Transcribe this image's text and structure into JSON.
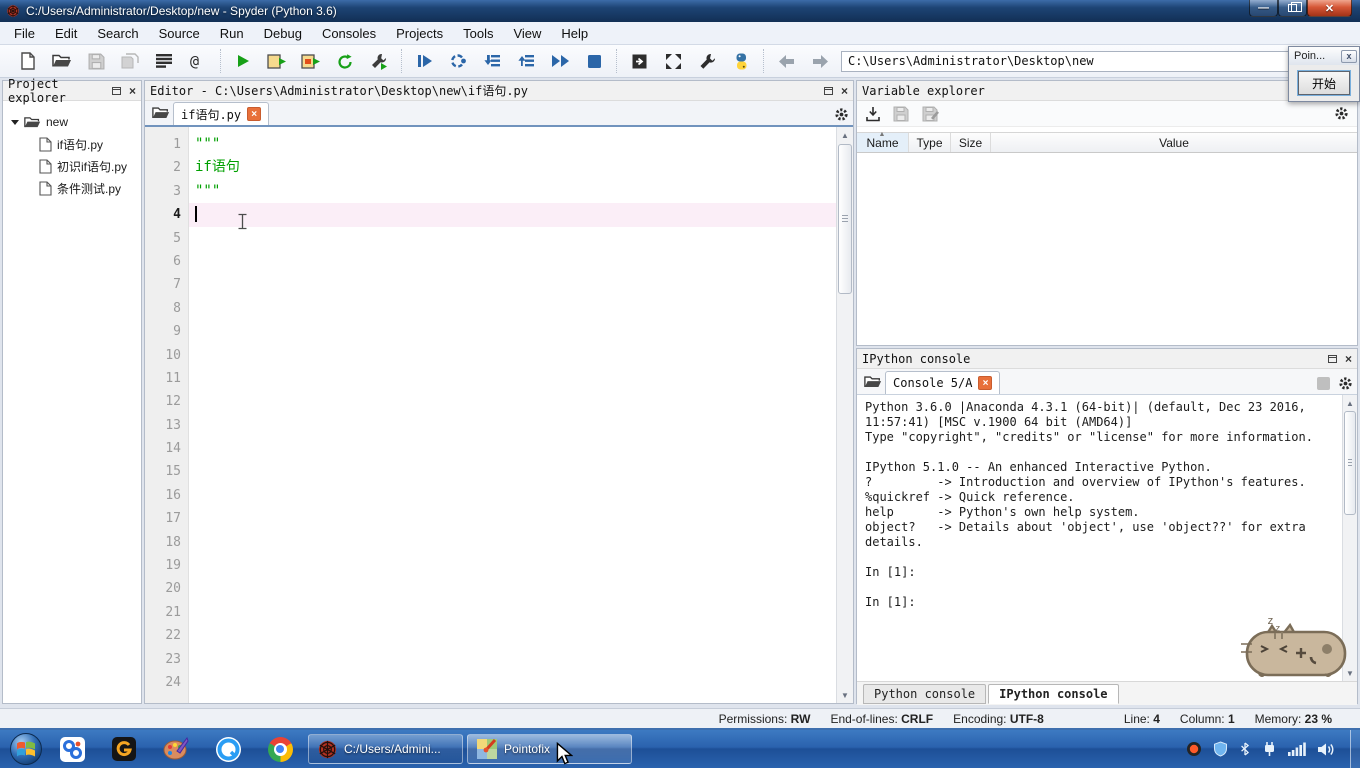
{
  "window": {
    "title": "C:/Users/Administrator/Desktop/new - Spyder (Python 3.6)"
  },
  "menu": {
    "items": [
      "File",
      "Edit",
      "Search",
      "Source",
      "Run",
      "Debug",
      "Consoles",
      "Projects",
      "Tools",
      "View",
      "Help"
    ]
  },
  "toolbar": {
    "path": "C:\\Users\\Administrator\\Desktop\\new"
  },
  "pointofix_window": {
    "title": "Poin...",
    "start_button": "开始"
  },
  "project_explorer": {
    "title": "Project explorer",
    "root_folder": "new",
    "files": [
      "if语句.py",
      "初识if语句.py",
      "条件测试.py"
    ]
  },
  "editor": {
    "title": "Editor - C:\\Users\\Administrator\\Desktop\\new\\if语句.py",
    "tab_label": "if语句.py",
    "total_lines": 24,
    "current_line": 4,
    "code_lines": {
      "1": "\"\"\"",
      "2": "if语句",
      "3": "\"\"\""
    }
  },
  "variable_explorer": {
    "title": "Variable explorer",
    "columns": [
      "Name",
      "Type",
      "Size",
      "Value"
    ]
  },
  "ipython_console": {
    "title": "IPython console",
    "tab_label": "Console 5/A",
    "banner": "Python 3.6.0 |Anaconda 4.3.1 (64-bit)| (default, Dec 23 2016,\n11:57:41) [MSC v.1900 64 bit (AMD64)]\nType \"copyright\", \"credits\" or \"license\" for more information.\n\nIPython 5.1.0 -- An enhanced Interactive Python.\n?         -> Introduction and overview of IPython's features.\n%quickref -> Quick reference.\nhelp      -> Python's own help system.\nobject?   -> Details about 'object', use 'object??' for extra\ndetails.\n\nIn [1]:\n\nIn [1]:",
    "bottom_tabs": [
      {
        "label": "Python console",
        "active": false
      },
      {
        "label": "IPython console",
        "active": true
      }
    ]
  },
  "status_bar": {
    "items": [
      {
        "label": "Permissions:",
        "value": "RW"
      },
      {
        "label": "End-of-lines:",
        "value": "CRLF"
      },
      {
        "label": "Encoding:",
        "value": "UTF-8"
      },
      {
        "label": "Line:",
        "value": "4"
      },
      {
        "label": "Column:",
        "value": "1"
      },
      {
        "label": "Memory:",
        "value": "23 %"
      }
    ]
  },
  "taskbar": {
    "tasks": [
      {
        "icon": "spyder-icon",
        "label": "C:/Users/Admini..."
      },
      {
        "icon": "pointofix-icon",
        "label": "Pointofix"
      }
    ],
    "pinned_icons": [
      "remote-app-icon",
      "g-app-icon",
      "paint-app-icon",
      "q-browser-icon",
      "chrome-icon"
    ],
    "tray_icons": [
      "record-icon",
      "security-shield-icon",
      "bluetooth-icon",
      "power-plug-icon",
      "network-signal-icon",
      "volume-icon"
    ]
  },
  "colors": {
    "docstring_green": "#00A000",
    "tab_close_orange": "#e8703a",
    "current_line_pink": "#fbeef7",
    "title_bar_blue": "#1d4474",
    "taskbar_blue": "#2a62ae"
  }
}
